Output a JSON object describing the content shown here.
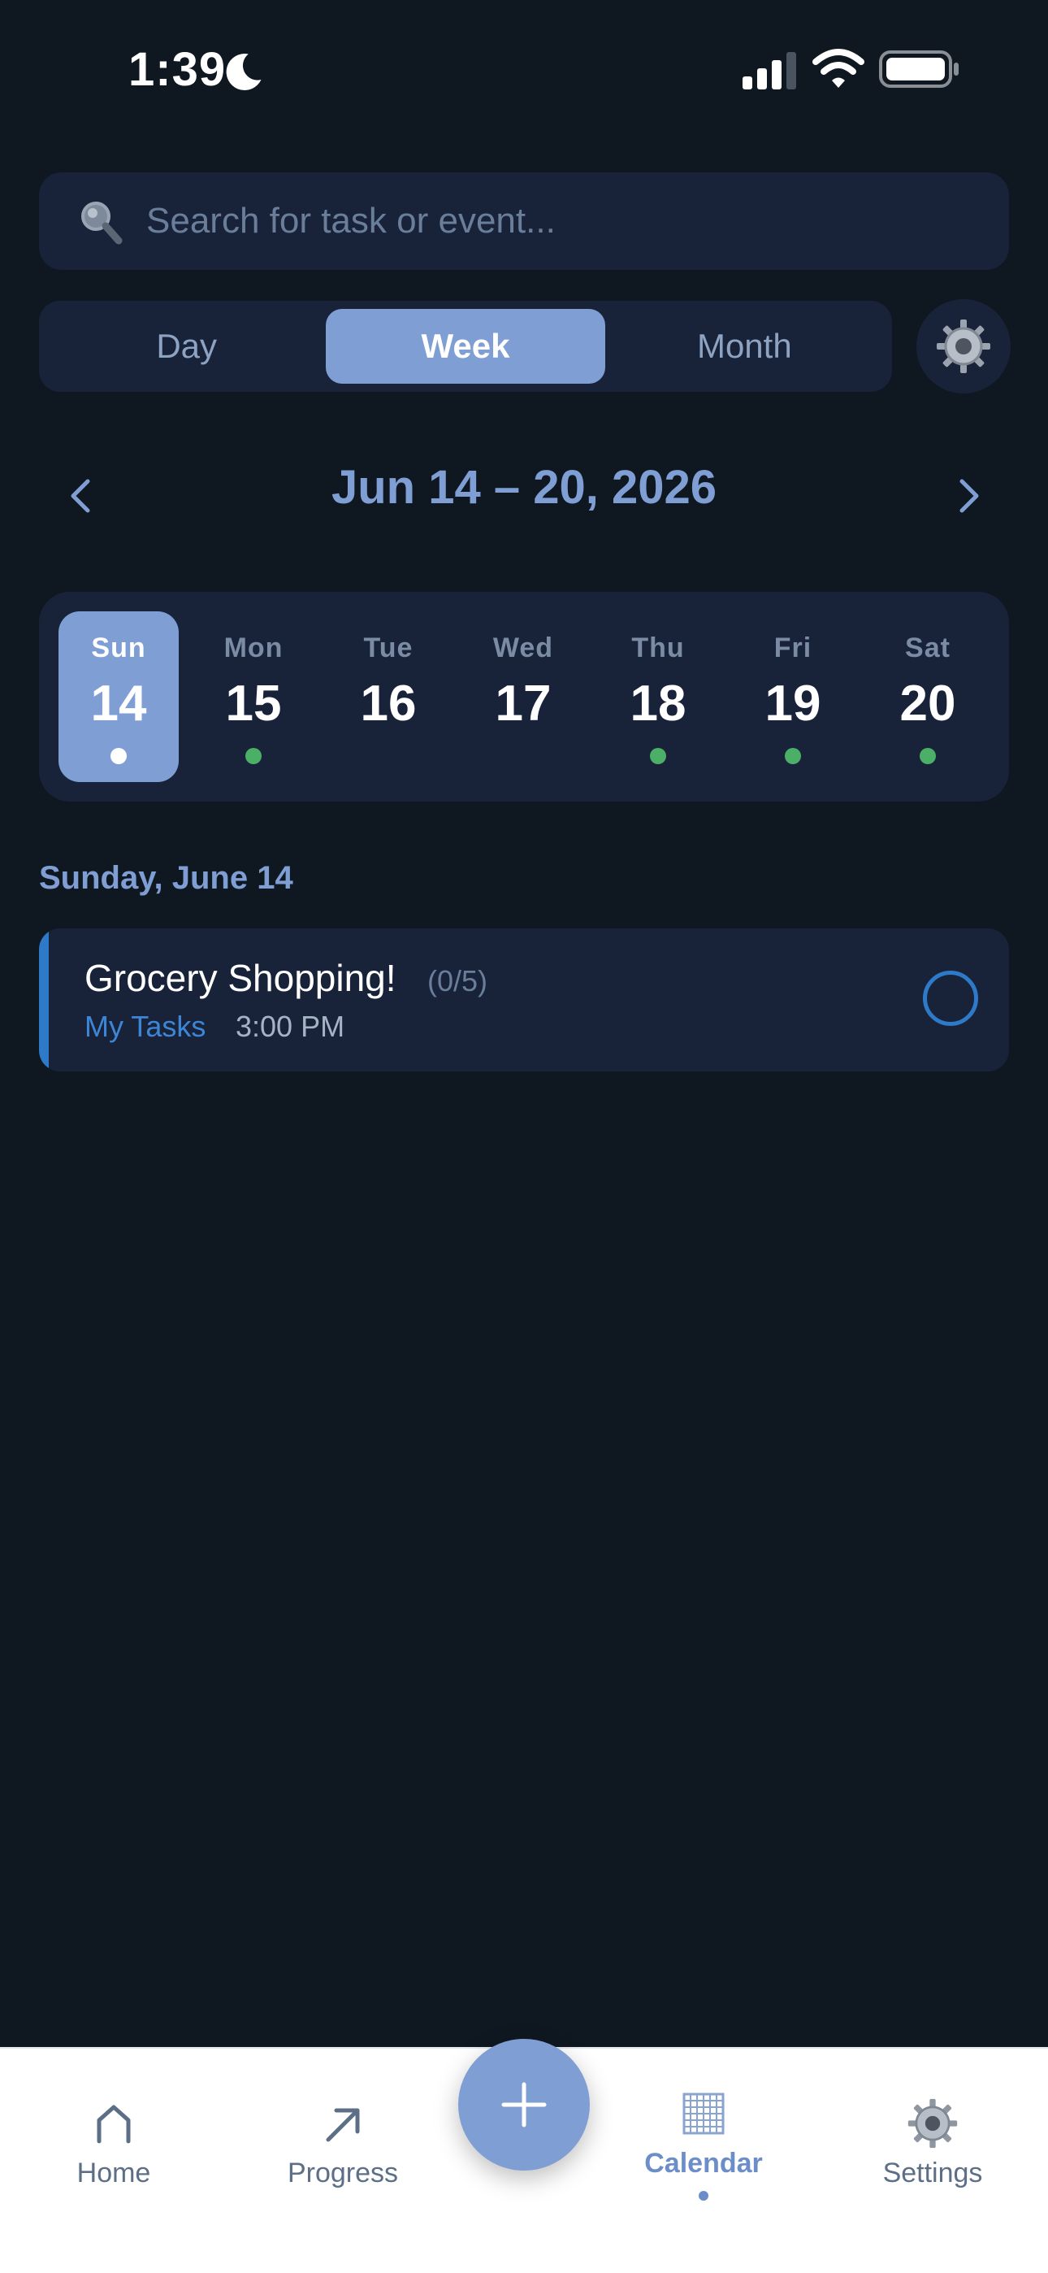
{
  "status_bar": {
    "time": "1:39"
  },
  "search": {
    "placeholder": "Search for task or event..."
  },
  "view_switch": {
    "tabs": [
      "Day",
      "Week",
      "Month"
    ],
    "active": "Week"
  },
  "week_nav": {
    "range": "Jun 14 – 20, 2026"
  },
  "week": {
    "days": [
      {
        "name": "Sun",
        "num": "14",
        "selected": true,
        "dot": "white"
      },
      {
        "name": "Mon",
        "num": "15",
        "selected": false,
        "dot": "green"
      },
      {
        "name": "Tue",
        "num": "16",
        "selected": false,
        "dot": "none"
      },
      {
        "name": "Wed",
        "num": "17",
        "selected": false,
        "dot": "none"
      },
      {
        "name": "Thu",
        "num": "18",
        "selected": false,
        "dot": "green"
      },
      {
        "name": "Fri",
        "num": "19",
        "selected": false,
        "dot": "green"
      },
      {
        "name": "Sat",
        "num": "20",
        "selected": false,
        "dot": "green"
      }
    ]
  },
  "section": {
    "heading": "Sunday, June 14"
  },
  "task": {
    "title": "Grocery Shopping!",
    "progress": "(0/5)",
    "list": "My Tasks",
    "time": "3:00 PM"
  },
  "tabbar": {
    "home": "Home",
    "progress": "Progress",
    "calendar": "Calendar",
    "settings": "Settings"
  },
  "colors": {
    "background": "#0f1821",
    "card": "#18233a",
    "accent": "#7f9ed4",
    "task_blue": "#2f79c9",
    "dot_green": "#4caf68"
  }
}
